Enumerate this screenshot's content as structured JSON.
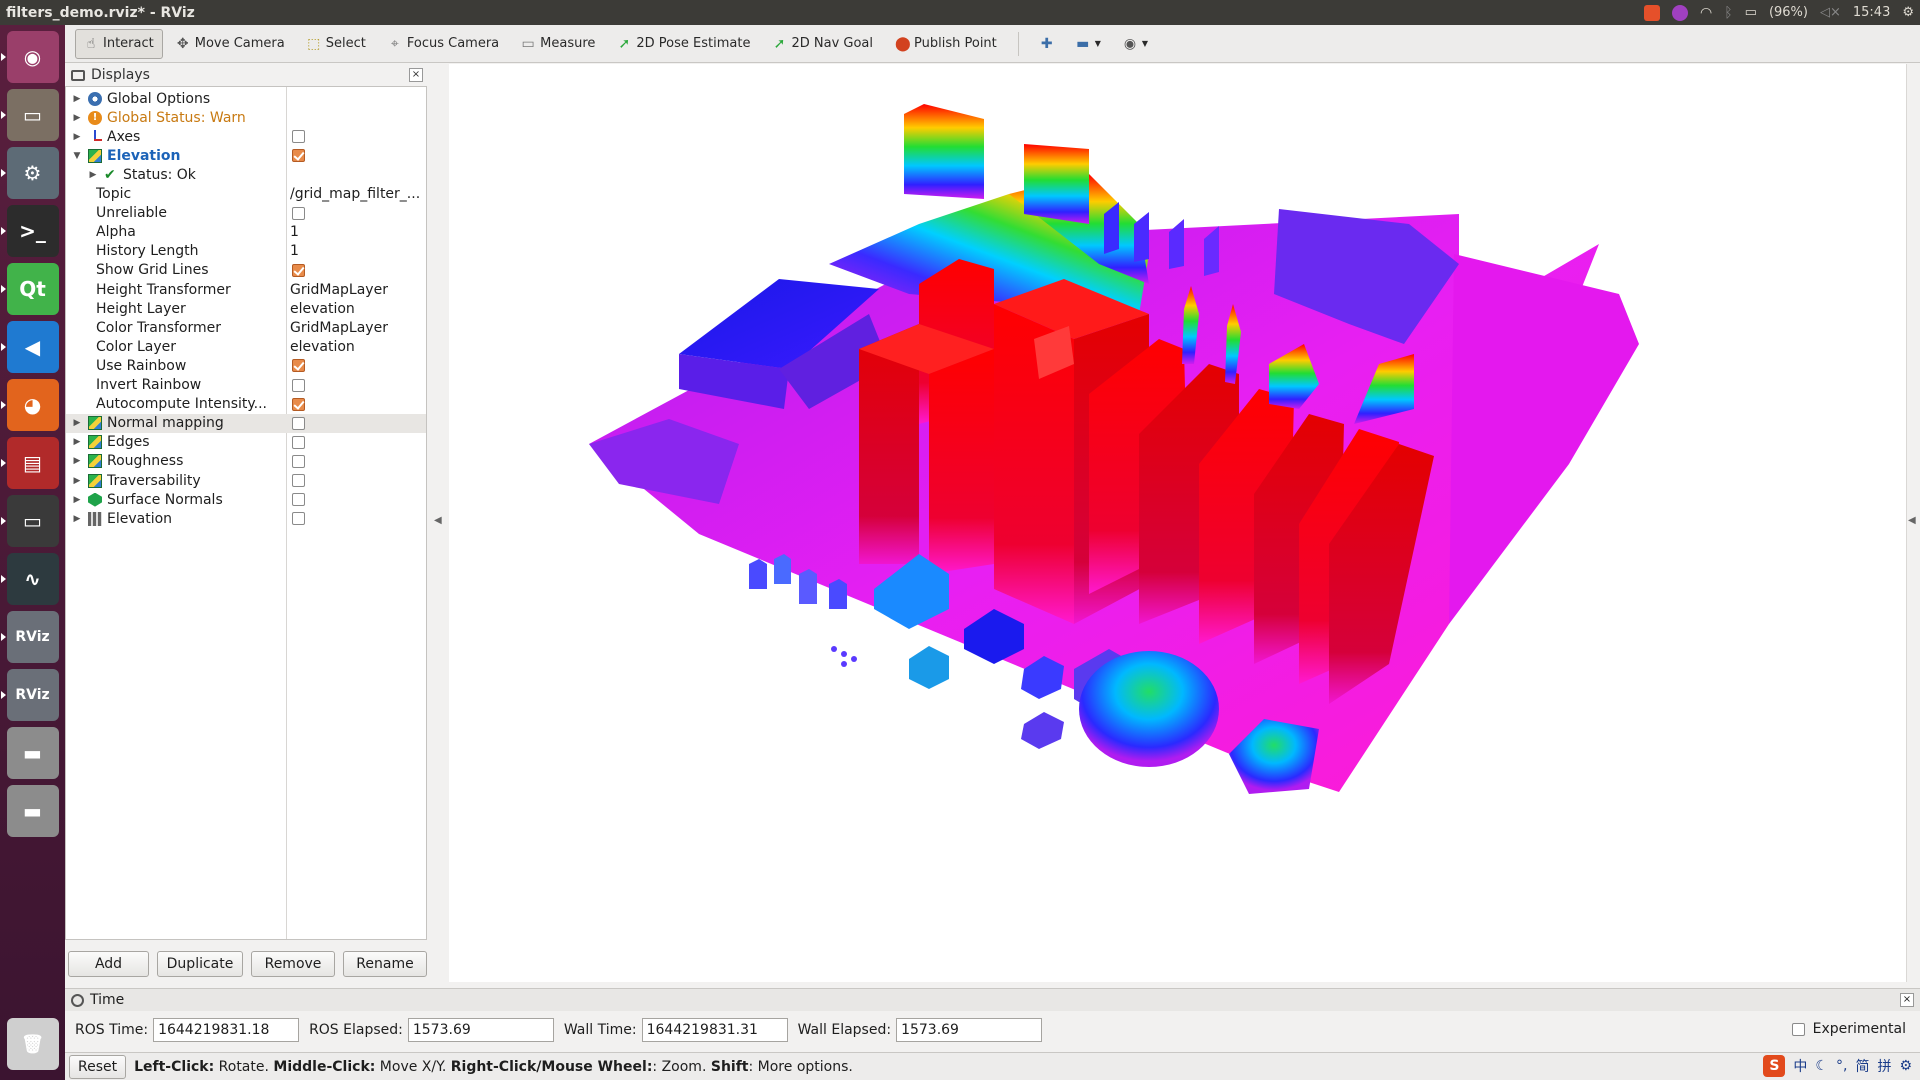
{
  "window": {
    "title": "filters_demo.rviz* - RViz"
  },
  "tray": {
    "battery": "(96%)",
    "clock": "15:43"
  },
  "launcher": {
    "items": [
      {
        "name": "ubuntu-dash-icon",
        "glyph": "◉",
        "color": "#9a3f6a"
      },
      {
        "name": "files-icon",
        "glyph": "▭",
        "color": "#7b6f63"
      },
      {
        "name": "settings-icon",
        "glyph": "⚙",
        "color": "#5d6b76"
      },
      {
        "name": "terminal-icon",
        "glyph": ">_",
        "color": "#2c2c2c"
      },
      {
        "name": "qt-creator-icon",
        "glyph": "Qt",
        "color": "#41b34a"
      },
      {
        "name": "vscode-icon",
        "glyph": "◀",
        "color": "#1f7ad1"
      },
      {
        "name": "firefox-icon",
        "glyph": "◕",
        "color": "#e2641d"
      },
      {
        "name": "app-red-icon",
        "glyph": "▤",
        "color": "#b12a2a"
      },
      {
        "name": "display-icon",
        "glyph": "▭",
        "color": "#3a3a3a"
      },
      {
        "name": "system-monitor-icon",
        "glyph": "∿",
        "color": "#2d3a3f"
      },
      {
        "name": "rviz-icon",
        "glyph": "RViz",
        "color": "#6a6f78"
      },
      {
        "name": "rviz-icon",
        "glyph": "RViz",
        "color": "#6a6f78"
      },
      {
        "name": "drive-icon",
        "glyph": "▬",
        "color": "#8c8c8c"
      },
      {
        "name": "drive-icon",
        "glyph": "▬",
        "color": "#8c8c8c"
      }
    ],
    "trash": {
      "glyph": "🗑",
      "color": "#cfcfcf"
    }
  },
  "toolbar": {
    "interact": "Interact",
    "move_camera": "Move Camera",
    "select": "Select",
    "focus_camera": "Focus Camera",
    "measure": "Measure",
    "pose_estimate": "2D Pose Estimate",
    "nav_goal": "2D Nav Goal",
    "publish_point": "Publish Point"
  },
  "displays": {
    "title": "Displays",
    "rows": [
      {
        "label": "Global Options",
        "icon": "gear",
        "arrow": "▶",
        "indent": 0
      },
      {
        "label": "Global Status: Warn",
        "icon": "warn",
        "arrow": "▶",
        "indent": 0,
        "color": "#c87a12"
      },
      {
        "label": "Axes",
        "icon": "axes",
        "arrow": "▶",
        "indent": 0,
        "checkbox": false
      },
      {
        "label": "Elevation",
        "icon": "layer",
        "arrow": "▼",
        "indent": 0,
        "checkbox": true,
        "color": "#1c63b8",
        "bold": true
      },
      {
        "label": "Status: Ok",
        "icon": "check",
        "arrow": "▶",
        "indent": 1
      },
      {
        "label": "Topic",
        "indent": 2,
        "value": "/grid_map_filter_..."
      },
      {
        "label": "Unreliable",
        "indent": 2,
        "checkbox": false
      },
      {
        "label": "Alpha",
        "indent": 2,
        "value": "1"
      },
      {
        "label": "History Length",
        "indent": 2,
        "value": "1"
      },
      {
        "label": "Show Grid Lines",
        "indent": 2,
        "checkbox": true
      },
      {
        "label": "Height Transformer",
        "indent": 2,
        "value": "GridMapLayer"
      },
      {
        "label": "Height Layer",
        "indent": 2,
        "value": "elevation"
      },
      {
        "label": "Color Transformer",
        "indent": 2,
        "value": "GridMapLayer"
      },
      {
        "label": "Color Layer",
        "indent": 2,
        "value": "elevation"
      },
      {
        "label": "Use Rainbow",
        "indent": 2,
        "checkbox": true
      },
      {
        "label": "Invert Rainbow",
        "indent": 2,
        "checkbox": false
      },
      {
        "label": "Autocompute Intensity...",
        "indent": 2,
        "checkbox": true
      },
      {
        "label": "Normal mapping",
        "icon": "layer",
        "arrow": "▶",
        "indent": 0,
        "checkbox": false,
        "selected": true
      },
      {
        "label": "Edges",
        "icon": "layer",
        "arrow": "▶",
        "indent": 0,
        "checkbox": false
      },
      {
        "label": "Roughness",
        "icon": "layer",
        "arrow": "▶",
        "indent": 0,
        "checkbox": false
      },
      {
        "label": "Traversability",
        "icon": "layer",
        "arrow": "▶",
        "indent": 0,
        "checkbox": false
      },
      {
        "label": "Surface Normals",
        "icon": "normals",
        "arrow": "▶",
        "indent": 0,
        "checkbox": false
      },
      {
        "label": "Elevation",
        "icon": "grid",
        "arrow": "▶",
        "indent": 0,
        "checkbox": false
      }
    ],
    "buttons": {
      "add": "Add",
      "duplicate": "Duplicate",
      "remove": "Remove",
      "rename": "Rename"
    }
  },
  "time": {
    "title": "Time",
    "ros_time_label": "ROS Time:",
    "ros_time": "1644219831.18",
    "ros_elapsed_label": "ROS Elapsed:",
    "ros_elapsed": "1573.69",
    "wall_time_label": "Wall Time:",
    "wall_time": "1644219831.31",
    "wall_elapsed_label": "Wall Elapsed:",
    "wall_elapsed": "1573.69",
    "experimental": "Experimental"
  },
  "status": {
    "reset": "Reset",
    "left_click": "Left-Click:",
    "left_click_desc": " Rotate. ",
    "middle_click": "Middle-Click:",
    "middle_click_desc": " Move X/Y. ",
    "right_click": "Right-Click/Mouse Wheel:",
    "right_click_desc": ": Zoom. ",
    "shift": "Shift",
    "shift_desc": ": More options."
  },
  "ime": {
    "s": "S",
    "lang": "中",
    "simplified": "简",
    "pinyin": "拼"
  }
}
